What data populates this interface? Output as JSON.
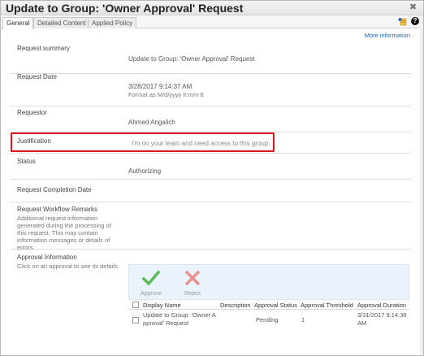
{
  "window": {
    "title": "Update to Group: 'Owner Approval' Request",
    "close_glyph": "✖"
  },
  "tabs": [
    {
      "label": "General"
    },
    {
      "label": "Detailed Content"
    },
    {
      "label": "Applied Policy"
    }
  ],
  "toolbar": {
    "help_glyph": "?",
    "more_info": "More information"
  },
  "fields": {
    "summary": {
      "label": "Request summary",
      "value": "Update to Group: 'Owner Approval' Request"
    },
    "date": {
      "label": "Request Date",
      "value": "3/28/2017 9:14:37 AM",
      "format": "Format as M/d/yyyy h:mm tt"
    },
    "requestor": {
      "label": "Requestor",
      "value": "Ahmed Angalich"
    },
    "justification": {
      "label": "Justification",
      "value": "I'm on your team and need access to this group."
    },
    "status": {
      "label": "Status",
      "value": "Authorizing"
    },
    "completion": {
      "label": "Request Completion Date",
      "value": ""
    },
    "workflow": {
      "label": "Request Workflow Remarks",
      "description": "Additional request information generated during the processing of this request. This may contain information messages or details of errors."
    },
    "approval": {
      "label": "Approval Information",
      "description": "Click on an approval to see its details"
    }
  },
  "approval_actions": {
    "approve": "Approve",
    "reject": "Reject"
  },
  "approval_grid": {
    "columns": [
      "Display Name",
      "Description",
      "Approval Status",
      "Approval Threshold",
      "Approval Duration"
    ],
    "rows": [
      {
        "display_name_line1": "Update to Group: 'Owner A",
        "display_name_line2": "pproval' Request",
        "description": "",
        "status": "Pending",
        "threshold": "1",
        "duration_line1": "3/31/2017 9:14:38",
        "duration_line2": "AM"
      }
    ]
  },
  "colors": {
    "link": "#2a63b3",
    "highlight": "#e0141e",
    "approve": "#5cb85c",
    "reject": "#e89090",
    "panel": "#eaf3fc"
  },
  "icons": [
    "close-icon",
    "add-note-icon",
    "help-icon",
    "approve-check-icon",
    "reject-x-icon"
  ]
}
